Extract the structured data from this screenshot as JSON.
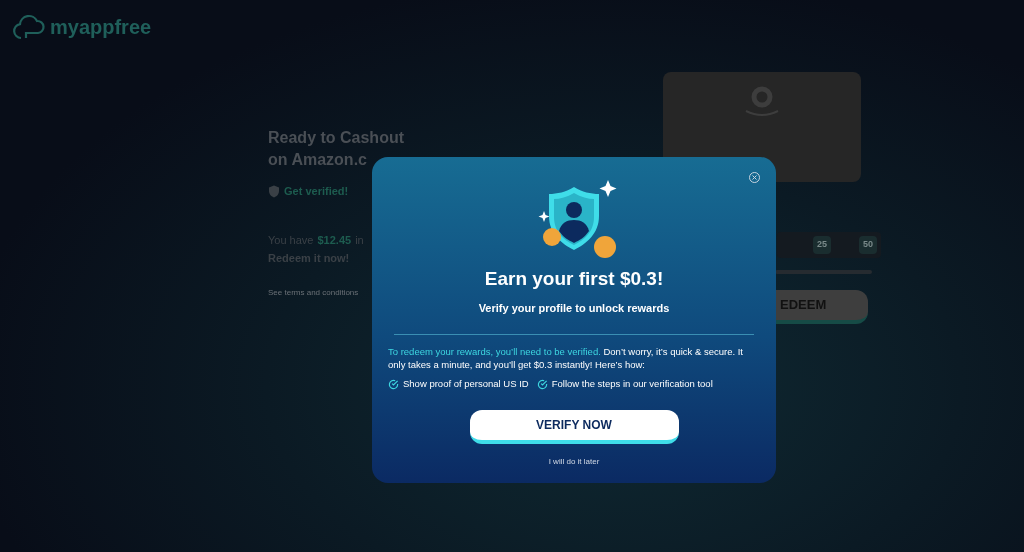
{
  "logo": {
    "text": "myappfree"
  },
  "cashout": {
    "title_lines": [
      "Ready to Cashout",
      "on Amazon.c"
    ],
    "verify_link": "Get verified!",
    "balance_prefix": "You have",
    "balance_amount": "$12.45",
    "balance_suffix": "in",
    "redeem_prompt": "Redeem it now!",
    "terms": "See terms and conditions"
  },
  "amounts": [
    "25",
    "50"
  ],
  "redeem_button": "EDEEM",
  "modal": {
    "title": "Earn your first $0.3!",
    "subtitle": "Verify your profile to unlock rewards",
    "body_highlight": "To redeem your rewards, you’ll need to be verified.",
    "body": " Don’t worry, it’s quick & secure. It only takes a minute, and you’ll get $0.3 instantly! Here’s how:",
    "steps": [
      "Show proof of personal US ID",
      "Follow the steps in our verification tool"
    ],
    "primary_button": "VERIFY NOW",
    "secondary_link": "I will do it later"
  }
}
